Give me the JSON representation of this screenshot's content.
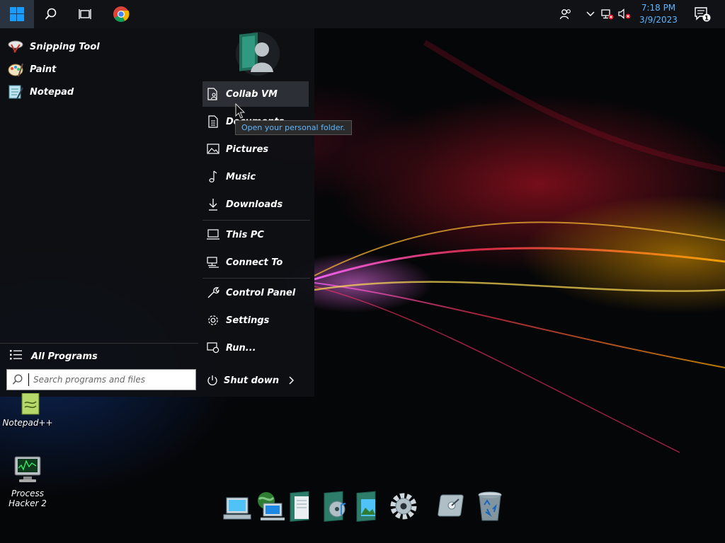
{
  "taskbar": {
    "clock_time": "7:18 PM",
    "clock_date": "3/9/2023",
    "notification_count": "1"
  },
  "start_menu": {
    "pinned": [
      {
        "label": "Snipping Tool",
        "icon": "snipping-tool-icon"
      },
      {
        "label": "Paint",
        "icon": "paint-icon"
      },
      {
        "label": "Notepad",
        "icon": "notepad-icon"
      }
    ],
    "all_programs": "All Programs",
    "search_placeholder": "Search programs and files",
    "links": [
      {
        "label": "Collab VM",
        "icon": "user-folder-icon"
      },
      {
        "label": "Documents",
        "icon": "documents-icon"
      },
      {
        "label": "Pictures",
        "icon": "pictures-icon"
      },
      {
        "label": "Music",
        "icon": "music-icon"
      },
      {
        "label": "Downloads",
        "icon": "downloads-icon"
      },
      {
        "label": "This PC",
        "icon": "computer-icon"
      },
      {
        "label": "Connect To",
        "icon": "connect-icon"
      },
      {
        "label": "Control Panel",
        "icon": "wrench-icon"
      },
      {
        "label": "Settings",
        "icon": "gear-icon"
      },
      {
        "label": "Run...",
        "icon": "run-icon"
      }
    ],
    "shutdown": "Shut down",
    "tooltip": "Open your personal folder."
  },
  "desktop_icons": [
    {
      "label": "Notepad++"
    },
    {
      "label": "Process Hacker 2"
    }
  ],
  "colors": {
    "accent": "#0a84ff",
    "clock": "#5fb6ff",
    "tooltip_text": "#5fb6ff"
  }
}
